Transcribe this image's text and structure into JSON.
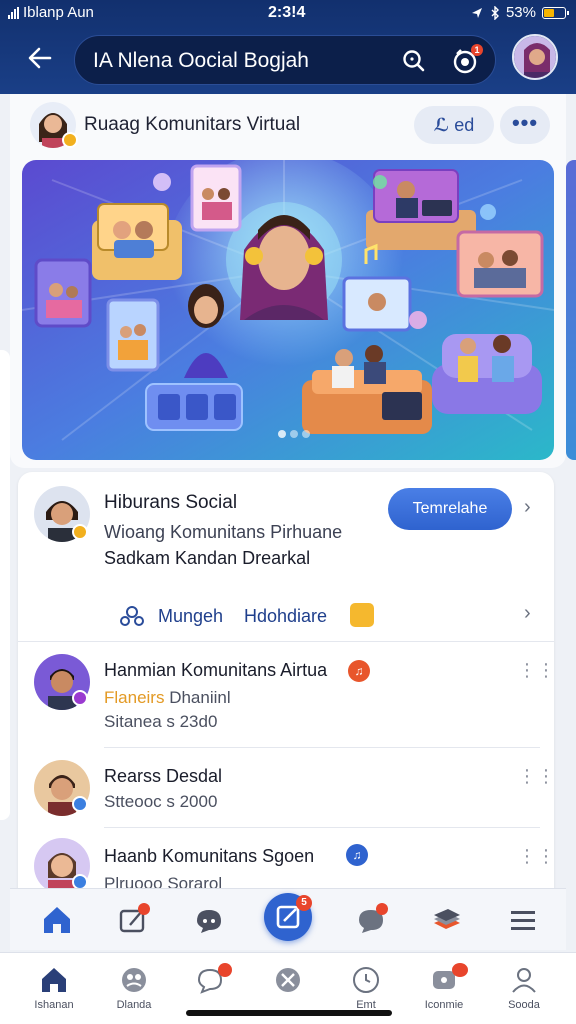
{
  "status_bar": {
    "carrier": "Iblanp Aun",
    "time": "2:3!4",
    "battery": "53%",
    "battery_level": 0.53
  },
  "header": {
    "title": "IA Nlena Oocial Bogjah",
    "notification_count": "1"
  },
  "community": {
    "name": "Ruaag Komunitars Virtual",
    "join_label": "ed",
    "more_label": "•••"
  },
  "featured": {
    "title": "Hiburans Social",
    "subtitle": "Wioang Komunitans Pirhuane",
    "description": "Sadkam Kandan Drearkal",
    "cta_label": "Temrelahe",
    "links": {
      "label_1": "Mungeh",
      "label_2": "Hdohdiare"
    }
  },
  "feed_items": [
    {
      "title": "Hanmian Komunitans Airtua",
      "meta_highlight": "Flaneirs",
      "meta_rest": "Dhaniinl",
      "meta_2": "Sitanea s 23d0",
      "tag_color": "#e8562c"
    },
    {
      "title": "Rearss Desdal",
      "meta_2": "Stteooc s 2000",
      "tag_color": "#3b7fe0"
    },
    {
      "title": "Haanb Komunitans Sgoen",
      "meta_2": "Plruooo Sorarol",
      "tag_color": "#2f63cf"
    }
  ],
  "action_bar": {
    "fab_badge": "5"
  },
  "bottom_nav": [
    {
      "label": "Ishanan",
      "icon": "home-icon"
    },
    {
      "label": "Dlanda",
      "icon": "community-icon"
    },
    {
      "label": "",
      "icon": "chat-icon"
    },
    {
      "label": "",
      "icon": "explore-icon"
    },
    {
      "label": "Emt",
      "icon": "clock-icon"
    },
    {
      "label": "Iconmie",
      "icon": "message-icon"
    },
    {
      "label": "Sooda",
      "icon": "profile-icon"
    }
  ],
  "colors": {
    "brand_dark": "#12306e",
    "primary": "#2f63cf",
    "badge": "#e8452c",
    "accent_yellow": "#f5b82e"
  }
}
